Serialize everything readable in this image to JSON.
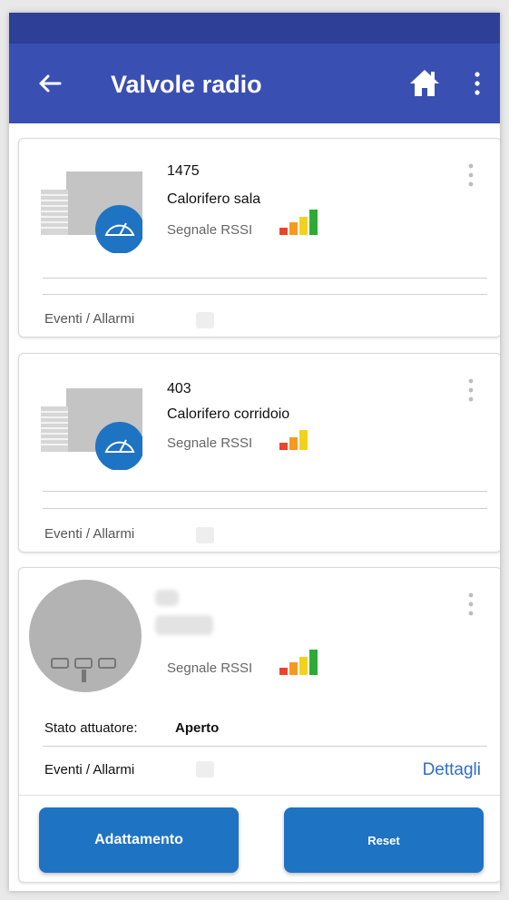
{
  "header": {
    "title": "Valvole radio"
  },
  "icons": {
    "back": "arrow-left",
    "home": "home",
    "overflow": "more-vertical"
  },
  "colors": {
    "status_bar": "#2e3f97",
    "app_bar": "#3a4fb2",
    "accent": "#1f73c3",
    "link": "#2f6fc4"
  },
  "cards": [
    {
      "id": "1475",
      "name": "Calorifero sala",
      "rssi_label": "Segnale RSSI",
      "rssi_level": 4,
      "events_label": "Eventi / Allarmi"
    },
    {
      "id": "403",
      "name": "Calorifero corridoio",
      "rssi_label": "Segnale RSSI",
      "rssi_level": 3,
      "events_label": "Eventi / Allarmi"
    },
    {
      "id": "",
      "name": "",
      "rssi_label": "Segnale RSSI",
      "rssi_level": 4,
      "state_label": "Stato attuatore:",
      "state_value": "Aperto",
      "events_label": "Eventi / Allarmi",
      "details_label": "Dettagli",
      "buttons": {
        "adapt": "Adattamento",
        "reset": "Reset"
      }
    }
  ]
}
